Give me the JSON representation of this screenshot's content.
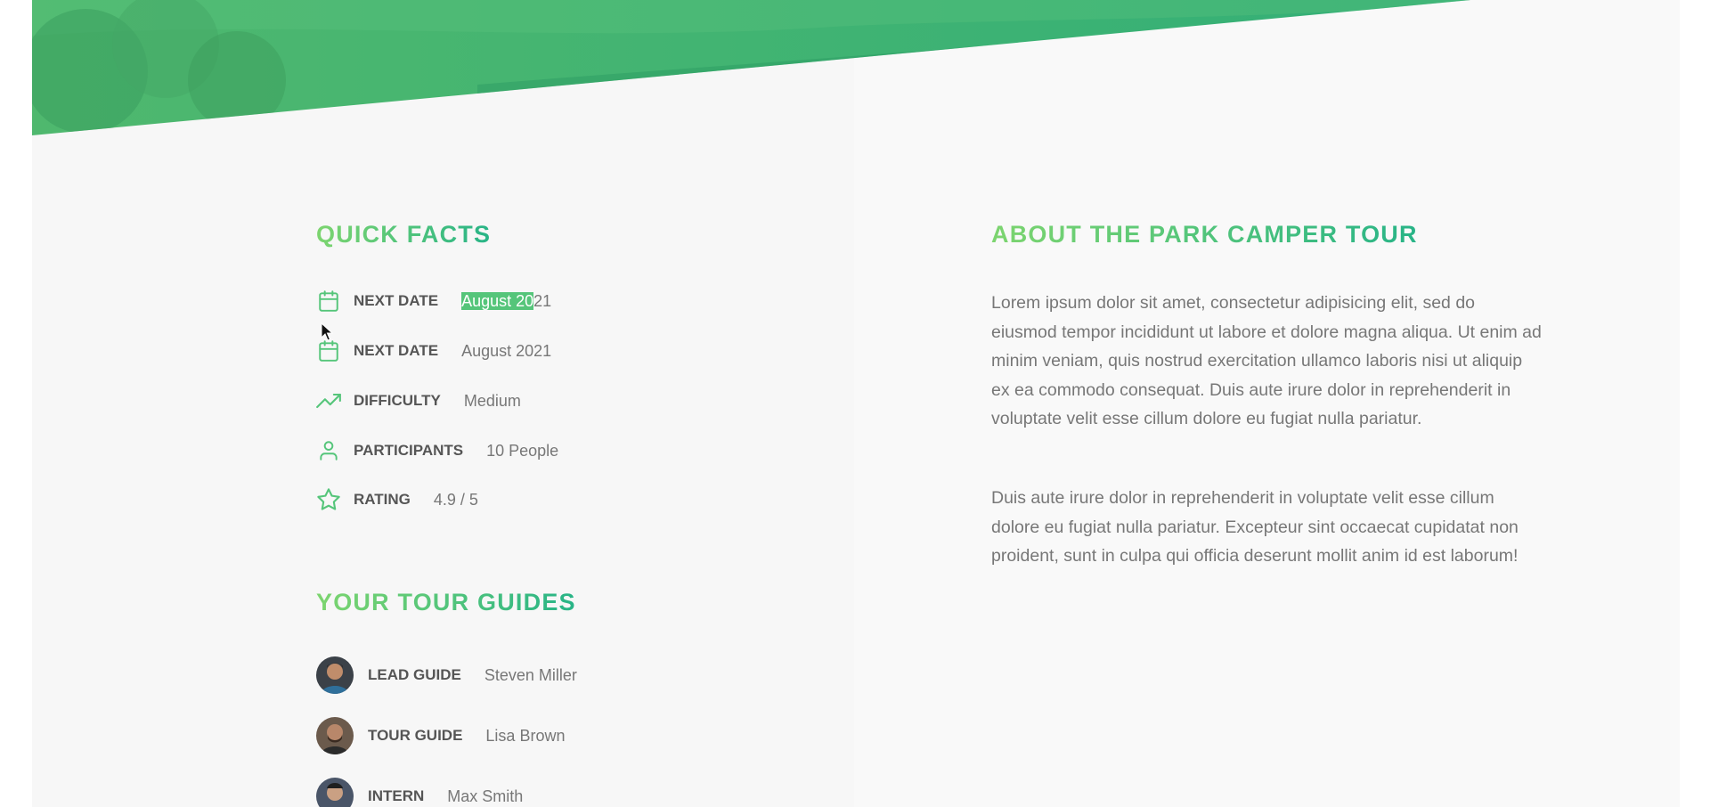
{
  "colors": {
    "accent_light": "#7dd56f",
    "accent_dark": "#28b487",
    "highlight": "#55c57a"
  },
  "quick_facts": {
    "title": "Quick facts",
    "items": [
      {
        "icon": "calendar-icon",
        "label": "Next date",
        "value_selected": "August 20",
        "value_rest": "21"
      },
      {
        "icon": "calendar-icon",
        "label": "Next date",
        "value": "August 2021"
      },
      {
        "icon": "trending-up-icon",
        "label": "Difficulty",
        "value": "Medium"
      },
      {
        "icon": "user-icon",
        "label": "Participants",
        "value": "10 People"
      },
      {
        "icon": "star-icon",
        "label": "Rating",
        "value": "4.9 / 5"
      }
    ]
  },
  "guides": {
    "title": "Your tour guides",
    "items": [
      {
        "role": "Lead guide",
        "name": "Steven Miller"
      },
      {
        "role": "Tour guide",
        "name": "Lisa Brown"
      },
      {
        "role": "Intern",
        "name": "Max Smith"
      }
    ]
  },
  "about": {
    "title": "About the park camper tour",
    "paragraphs": [
      "Lorem ipsum dolor sit amet, consectetur adipisicing elit, sed do eiusmod tempor incididunt ut labore et dolore magna aliqua. Ut enim ad minim veniam, quis nostrud exercitation ullamco laboris nisi ut aliquip ex ea commodo consequat. Duis aute irure dolor in reprehenderit in voluptate velit esse cillum dolore eu fugiat nulla pariatur.",
      "Duis aute irure dolor in reprehenderit in voluptate velit esse cillum dolore eu fugiat nulla pariatur. Excepteur sint occaecat cupidatat non proident, sunt in culpa qui officia deserunt mollit anim id est laborum!"
    ]
  }
}
